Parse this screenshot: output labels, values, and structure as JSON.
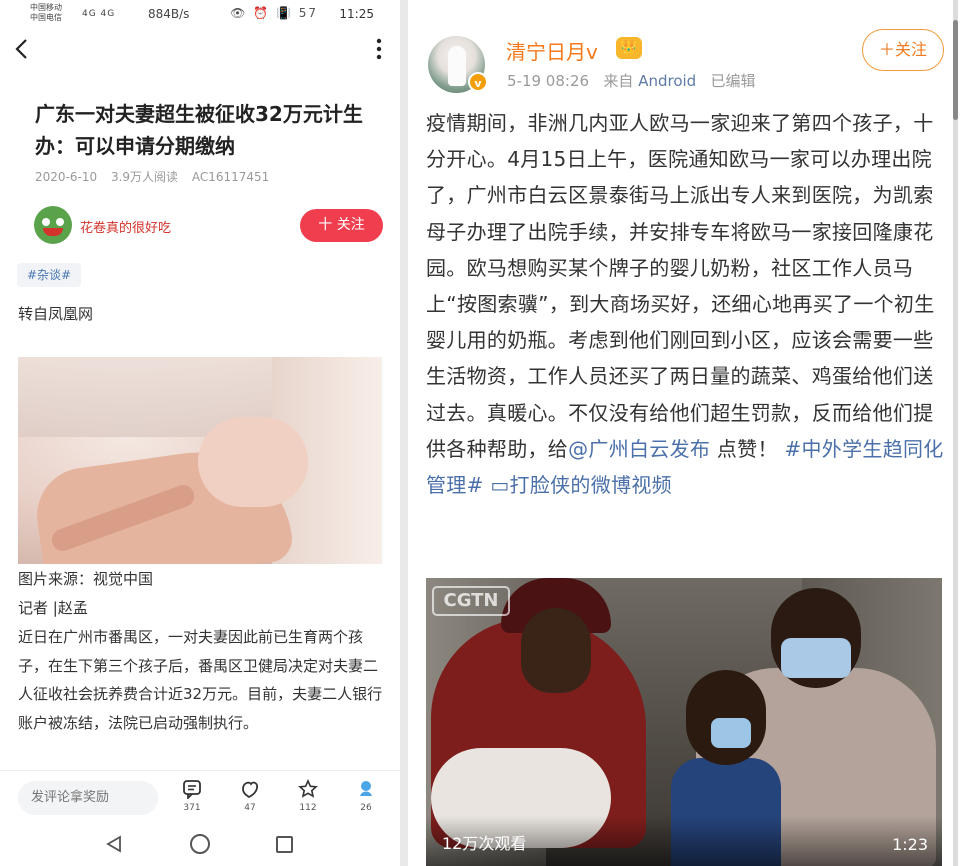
{
  "left": {
    "status": {
      "carrier1": "中国移动",
      "carrier2": "中国电信",
      "signal": "4G 4G",
      "speed": "884B/s",
      "icons": "👁 ⏰ 📳 57",
      "time": "11:25"
    },
    "article": {
      "title": "广东一对夫妻超生被征收32万元计生办：可以申请分期缴纳",
      "date": "2020-6-10",
      "reads": "3.9万人阅读",
      "id": "AC16117451"
    },
    "author": {
      "name": "花卷真的很好吃",
      "follow_label": "十 关注"
    },
    "tag": "#杂谈#",
    "repost": "转自凤凰网",
    "caption": "图片来源：视觉中国",
    "reporter": "记者 |赵孟",
    "body": "近日在广州市番禺区，一对夫妻因此前已生育两个孩子，在生下第三个孩子后，番禺区卫健局决定对夫妻二人征收社会抚养费合计近32万元。目前，夫妻二人银行账户被冻结，法院已启动强制执行。",
    "bottom": {
      "comment_placeholder": "发评论拿奖励",
      "comments": "371",
      "likes": "47",
      "favorites": "112",
      "shares": "26"
    },
    "icons": {
      "back": "chevron-left-icon",
      "more": "more-vertical-icon",
      "comment": "comment-icon",
      "like": "like-icon",
      "star": "star-icon",
      "share": "share-icon"
    }
  },
  "right": {
    "user": {
      "name": "清宁日月v",
      "badge": "v",
      "crown": "👑"
    },
    "post": {
      "time": "5-19 08:26",
      "source_prefix": "来自",
      "source": "Android",
      "edited": "已编辑",
      "follow_label": "＋关注",
      "text_main": "疫情期间，非洲几内亚人欧马一家迎来了第四个孩子，十分开心。4月15日上午，医院通知欧马一家可以办理出院了，广州市白云区景泰街马上派出专人来到医院，为凯索母子办理了出院手续，并安排专车将欧马一家接回隆康花园。欧马想购买某个牌子的婴儿奶粉，社区工作人员马上“按图索骥”，到大商场买好，还细心地再买了一个初生婴儿用的奶瓶。考虑到他们刚回到小区，应该会需要一些生活物资，工作人员还买了两日量的蔬菜、鸡蛋给他们送过去。真暖心。不仅没有给他们超生罚款，反而给他们提供各种帮助，给",
      "mention": "@广州白云发布",
      "after_mention": " 点赞！ ",
      "hashtag": "#中外学生趋同化管理#",
      "video_link": " ▭打脸侠的微博视频"
    },
    "video": {
      "logo": "CGTN",
      "views": "12万次观看",
      "duration": "1:23"
    }
  },
  "colors": {
    "accent_red": "#f03e4f",
    "weibo_orange": "#f47a1c",
    "link_blue": "#4b70a9"
  }
}
